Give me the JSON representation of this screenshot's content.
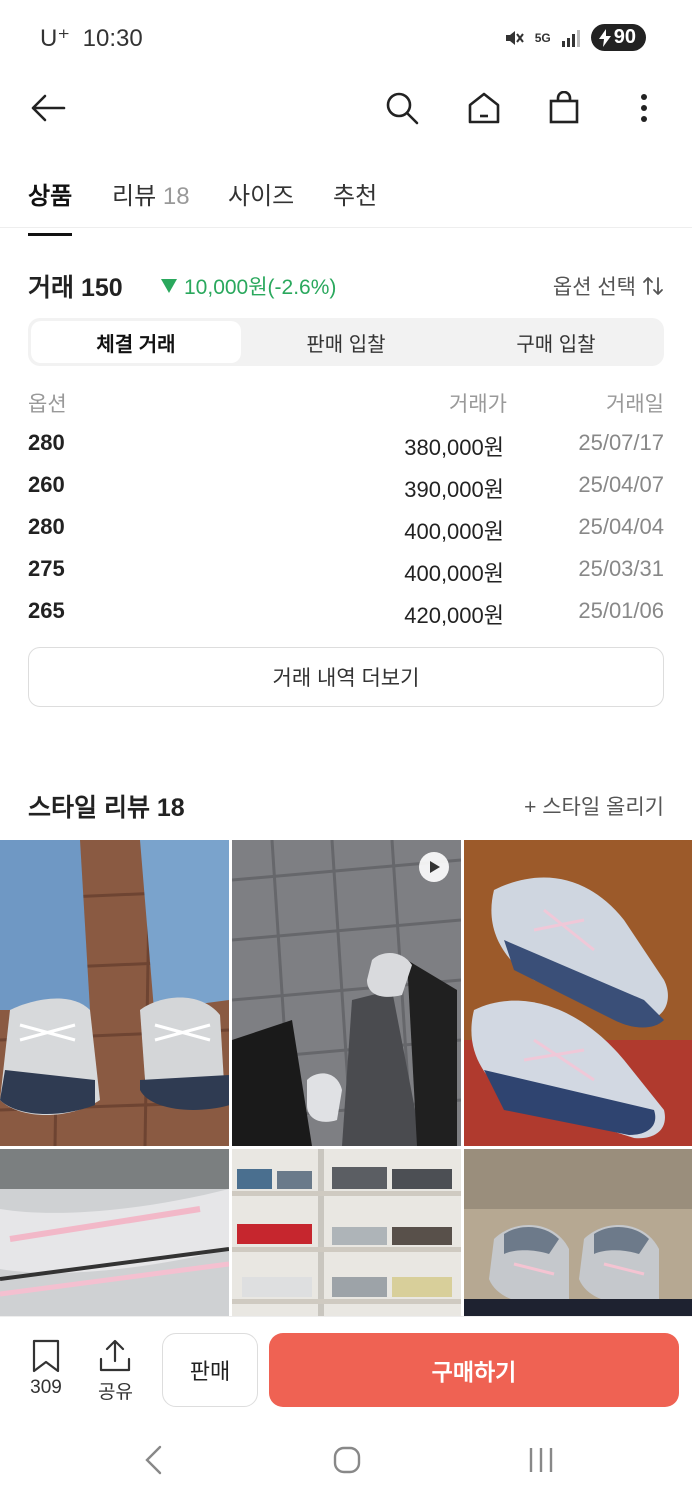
{
  "status_bar": {
    "carrier": "U⁺",
    "time": "10:30",
    "network": "5G",
    "battery": "90"
  },
  "tabs": [
    {
      "label": "상품",
      "count": ""
    },
    {
      "label": "리뷰",
      "count": "18"
    },
    {
      "label": "사이즈",
      "count": ""
    },
    {
      "label": "추천",
      "count": ""
    }
  ],
  "trade": {
    "title": "거래 150",
    "change": "10,000원(-2.6%)",
    "change_color": "#2aa85d",
    "option_select": "옵션 선택",
    "segments": [
      "체결 거래",
      "판매 입찰",
      "구매 입찰"
    ],
    "columns": [
      "옵션",
      "거래가",
      "거래일"
    ],
    "rows": [
      {
        "option": "280",
        "price": "380,000원",
        "date": "25/07/17"
      },
      {
        "option": "260",
        "price": "390,000원",
        "date": "25/04/07"
      },
      {
        "option": "280",
        "price": "400,000원",
        "date": "25/04/04"
      },
      {
        "option": "275",
        "price": "400,000원",
        "date": "25/03/31"
      },
      {
        "option": "265",
        "price": "420,000원",
        "date": "25/01/06"
      }
    ],
    "more_button": "거래 내역 더보기"
  },
  "style_review": {
    "title": "스타일 리뷰 18",
    "upload": "+ 스타일 올리기"
  },
  "actions": {
    "bookmark_count": "309",
    "share_label": "공유",
    "sell_label": "판매",
    "buy_label": "구매하기",
    "buy_color": "#ef6253"
  }
}
